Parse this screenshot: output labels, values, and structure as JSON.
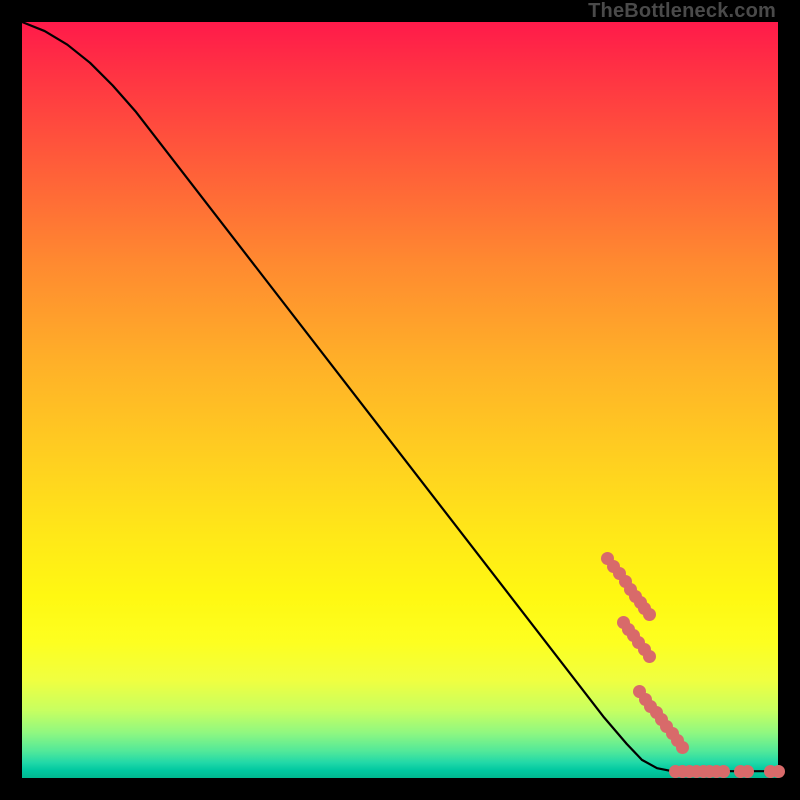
{
  "watermark": "TheBottleneck.com",
  "chart_data": {
    "type": "line",
    "title": "",
    "xlabel": "",
    "ylabel": "",
    "xlim": [
      0,
      100
    ],
    "ylim": [
      0,
      100
    ],
    "curve": [
      {
        "x": 0.0,
        "y": 100.0
      },
      {
        "x": 3.0,
        "y": 98.8
      },
      {
        "x": 6.0,
        "y": 97.0
      },
      {
        "x": 9.0,
        "y": 94.6
      },
      {
        "x": 12.0,
        "y": 91.6
      },
      {
        "x": 15.0,
        "y": 88.2
      },
      {
        "x": 77.0,
        "y": 8.0
      },
      {
        "x": 80.0,
        "y": 4.5
      },
      {
        "x": 82.0,
        "y": 2.4
      },
      {
        "x": 84.0,
        "y": 1.3
      },
      {
        "x": 86.0,
        "y": 0.9
      },
      {
        "x": 100.0,
        "y": 0.9
      }
    ],
    "points": [
      {
        "x": 77.5,
        "y": 29.0
      },
      {
        "x": 78.3,
        "y": 28.0
      },
      {
        "x": 79.0,
        "y": 27.0
      },
      {
        "x": 79.8,
        "y": 26.0
      },
      {
        "x": 80.5,
        "y": 25.0
      },
      {
        "x": 81.2,
        "y": 24.0
      },
      {
        "x": 81.8,
        "y": 23.2
      },
      {
        "x": 82.4,
        "y": 22.4
      },
      {
        "x": 83.0,
        "y": 21.6
      },
      {
        "x": 79.5,
        "y": 20.6
      },
      {
        "x": 80.2,
        "y": 19.7
      },
      {
        "x": 80.9,
        "y": 18.8
      },
      {
        "x": 81.6,
        "y": 17.9
      },
      {
        "x": 82.3,
        "y": 17.0
      },
      {
        "x": 83.0,
        "y": 16.1
      },
      {
        "x": 81.7,
        "y": 11.4
      },
      {
        "x": 82.5,
        "y": 10.4
      },
      {
        "x": 83.2,
        "y": 9.5
      },
      {
        "x": 83.9,
        "y": 8.6
      },
      {
        "x": 84.6,
        "y": 7.7
      },
      {
        "x": 85.3,
        "y": 6.8
      },
      {
        "x": 86.0,
        "y": 5.9
      },
      {
        "x": 86.7,
        "y": 5.0
      },
      {
        "x": 87.4,
        "y": 4.1
      },
      {
        "x": 86.5,
        "y": 0.9
      },
      {
        "x": 87.4,
        "y": 0.9
      },
      {
        "x": 88.3,
        "y": 0.9
      },
      {
        "x": 89.2,
        "y": 0.9
      },
      {
        "x": 90.1,
        "y": 0.9
      },
      {
        "x": 91.0,
        "y": 0.9
      },
      {
        "x": 91.9,
        "y": 0.9
      },
      {
        "x": 92.8,
        "y": 0.9
      },
      {
        "x": 95.0,
        "y": 0.9
      },
      {
        "x": 95.9,
        "y": 0.9
      },
      {
        "x": 99.0,
        "y": 0.9
      },
      {
        "x": 100.0,
        "y": 0.9
      }
    ]
  }
}
